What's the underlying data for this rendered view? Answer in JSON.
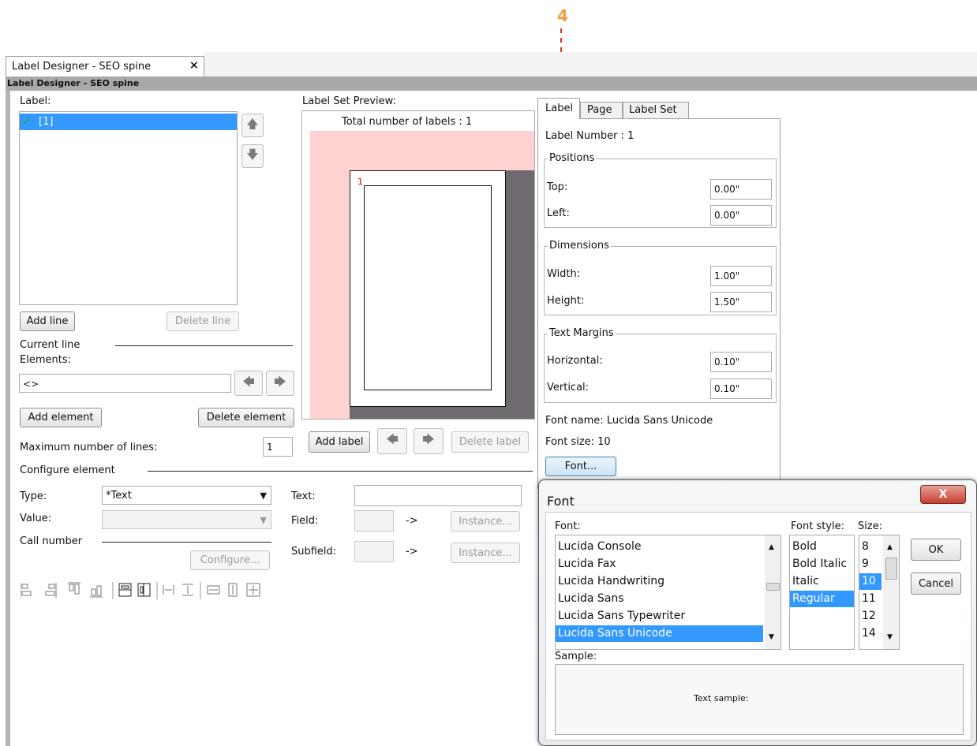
{
  "annotation": {
    "step_number": "4",
    "arrow_color": "#e03030",
    "number_color": "#f0a040"
  },
  "tab": {
    "title": "Label Designer - SEO spine",
    "close": "×"
  },
  "window_title": "Label Designer - SEO spine",
  "label_list": {
    "header": "Label:",
    "items": [
      {
        "check": "✓",
        "text": "[1]"
      }
    ]
  },
  "buttons": {
    "add_line": "Add line",
    "delete_line": "Delete line",
    "add_element": "Add element",
    "delete_element": "Delete element",
    "add_label": "Add label",
    "delete_label": "Delete label",
    "configure": "Configure...",
    "instance": "Instance...",
    "font": "Font..."
  },
  "current_line": {
    "label": "Current line",
    "elements_label": "Elements:",
    "elements_value": "<>"
  },
  "max_lines": {
    "label": "Maximum number of lines:",
    "value": "1"
  },
  "configure_element": {
    "label": "Configure element",
    "type_label": "Type:",
    "type_value": "*Text",
    "value_label": "Value:",
    "value_value": "",
    "call_number_label": "Call number",
    "text_label": "Text:",
    "text_value": "",
    "field_label": "Field:",
    "subfield_label": "Subfield:",
    "arrow": "->"
  },
  "preview": {
    "header": "Label Set Preview:",
    "total": "Total number of labels : 1",
    "label_index": "1"
  },
  "props_tabs": [
    "Label",
    "Page",
    "Label Set"
  ],
  "label_props": {
    "number": "Label Number : 1",
    "positions": {
      "title": "Positions",
      "top_label": "Top:",
      "top": "0.00\"",
      "left_label": "Left:",
      "left": "0.00\""
    },
    "dimensions": {
      "title": "Dimensions",
      "width_label": "Width:",
      "width": "1.00\"",
      "height_label": "Height:",
      "height": "1.50\""
    },
    "margins": {
      "title": "Text Margins",
      "h_label": "Horizontal:",
      "h": "0.10\"",
      "v_label": "Vertical:",
      "v": "0.10\""
    },
    "font_name": "Font name: Lucida Sans Unicode",
    "font_size": "Font size: 10"
  },
  "font_dialog": {
    "title": "Font",
    "close": "X",
    "font_label": "Font:",
    "style_label": "Font style:",
    "size_label": "Size:",
    "fonts": [
      "Lucida Console",
      "Lucida Fax",
      "Lucida Handwriting",
      "Lucida Sans",
      "Lucida Sans Typewriter",
      "Lucida Sans Unicode"
    ],
    "selected_font": "Lucida Sans Unicode",
    "styles": [
      "Bold",
      "Bold Italic",
      "Italic",
      "Regular"
    ],
    "selected_style": "Regular",
    "sizes": [
      "8",
      "9",
      "10",
      "11",
      "12",
      "14"
    ],
    "selected_size": "10",
    "ok": "OK",
    "cancel": "Cancel",
    "sample_label": "Sample:",
    "sample_text": "Text sample:"
  }
}
